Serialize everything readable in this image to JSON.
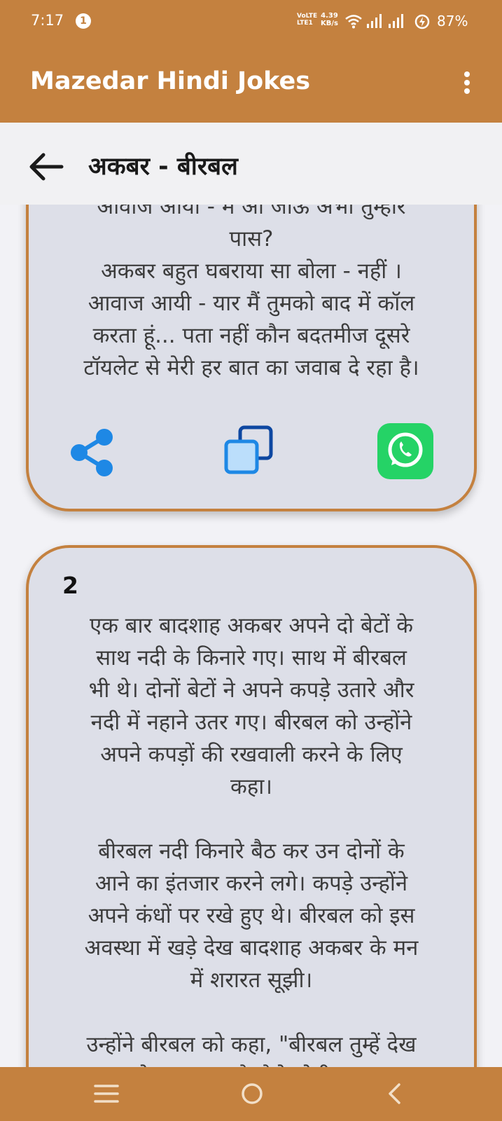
{
  "status_bar": {
    "time": "7:17",
    "notification_count": "1",
    "volte_line1": "VoLTE",
    "volte_line2": "LTE1",
    "speed_value": "4.39",
    "speed_unit": "KB/s",
    "battery": "87%"
  },
  "app_bar": {
    "title": "Mazedar Hindi Jokes",
    "menu_icon": "more-vertical-icon"
  },
  "header": {
    "back_icon": "arrow-left-icon",
    "title": "अकबर - बीरबल"
  },
  "jokes": [
    {
      "text": "आवाज आयी - मैं आ जाऊं अभी तुम्हारे\nपास?\nअकबर बहुत घबराया सा बोला - नहीं ।\nआवाज आयी - यार मैं तुमको बाद में कॉल\nकरता हूं... पता नहीं कौन बदतमीज दूसरे\nटॉयलेट से मेरी हर बात का जवाब दे रहा है।",
      "actions": [
        "share-icon",
        "copy-icon",
        "whatsapp-icon"
      ]
    },
    {
      "number": "2",
      "text": "एक बार बादशाह अकबर अपने दो बेटों के\nसाथ नदी के किनारे गए। साथ में बीरबल\nभी थे। दोनों बेटों ने अपने कपड़े उतारे और\nनदी में नहाने उतर गए। बीरबल को उन्होंने\nअपने कपड़ों की रखवाली करने के लिए\nकहा।\n\nबीरबल नदी किनारे बैठ कर उन दोनों के\nआने का इंतजार करने लगे। कपड़े उन्होंने\nअपने कंधों पर रखे हुए थे। बीरबल को इस\nअवस्था में खड़े देख बादशाह अकबर के मन\nमें शरारत सूझी।\n\nउन्होंने बीरबल को कहा, \"बीरबल तुम्हें देख\nकर ऐसा लग रह है जैसे धोबी का गधा"
    }
  ],
  "nav_bar": {
    "items": [
      "menu-lines-icon",
      "home-circle-icon",
      "back-chevron-icon"
    ]
  },
  "colors": {
    "primary": "#c4813f",
    "card_background": "#dddfe8",
    "share_blue": "#1e88e5",
    "whatsapp_green": "#25d366"
  }
}
